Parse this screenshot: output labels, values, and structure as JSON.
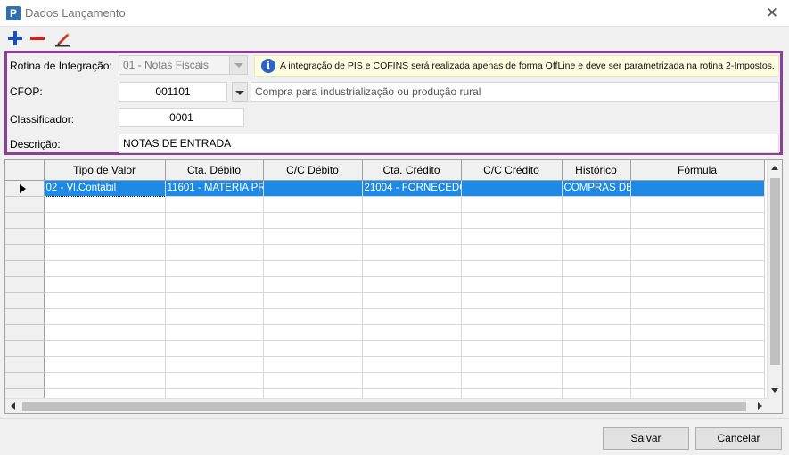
{
  "window": {
    "title": "Dados Lançamento",
    "app_icon_letter": "P"
  },
  "toolbar": {
    "add": "plus-icon",
    "remove": "minus-icon",
    "edit": "pencil-icon"
  },
  "form": {
    "rotina_label": "Rotina de Integração:",
    "rotina_value": "01 - Notas Fiscais",
    "info_message": "A integração de PIS e COFINS será realizada apenas de forma OffLine e deve ser parametrizada na rotina 2-Impostos.",
    "cfop_label": "CFOP:",
    "cfop_code": "001101",
    "cfop_description": "Compra para industrialização ou produção rural",
    "classificador_label": "Classificador:",
    "classificador_value": "0001",
    "descricao_label": "Descrição:",
    "descricao_value": "NOTAS DE ENTRADA"
  },
  "grid": {
    "columns": [
      "Tipo de Valor",
      "Cta. Débito",
      "C/C Débito",
      "Cta. Crédito",
      "C/C Crédito",
      "Histórico",
      "Fórmula"
    ],
    "rows": [
      [
        "02 - Vl.Contábil",
        "11601 - MATERIA PR",
        "",
        "21004 - FORNECEDO",
        "",
        "COMPRAS DE",
        ""
      ]
    ],
    "empty_rows": 13
  },
  "buttons": {
    "save_first": "S",
    "save_rest": "alvar",
    "cancel_first": "C",
    "cancel_rest": "ancelar"
  },
  "colors": {
    "accent_border": "#8e3d9a",
    "selection": "#1e88e5"
  }
}
